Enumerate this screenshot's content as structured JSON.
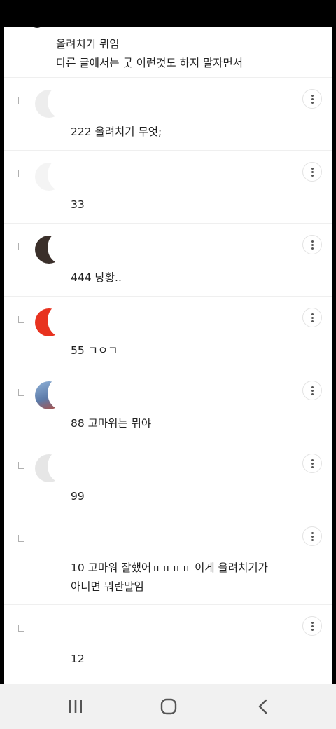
{
  "top_comment": {
    "line1": "올려치기 뭐임",
    "line2": "다른 글에서는 굿 이런것도 하지 말자면서"
  },
  "replies": [
    {
      "text": "222 올려치기 무엇;",
      "avatar_color": "#ededed"
    },
    {
      "text": "33",
      "avatar_color": "#f4f4f4"
    },
    {
      "text": "444 당황..",
      "avatar_color": "#3a2f2a"
    },
    {
      "text": "55 ㄱㅇㄱ",
      "avatar_color": "#e8321f"
    },
    {
      "text": "88 고마워는 뭐야",
      "avatar_color": "#6f8fb8"
    },
    {
      "text": "99",
      "avatar_color": "#e6e6e6"
    },
    {
      "line1": "10 고마워 잘했어ㅠㅠㅠㅠ 이게 올려치기가",
      "line2": "아니면 뭐란말임"
    },
    {
      "text": "12"
    }
  ],
  "navbar": {
    "recent_icon": "recent-apps-icon",
    "home_icon": "home-icon",
    "back_icon": "back-icon"
  }
}
